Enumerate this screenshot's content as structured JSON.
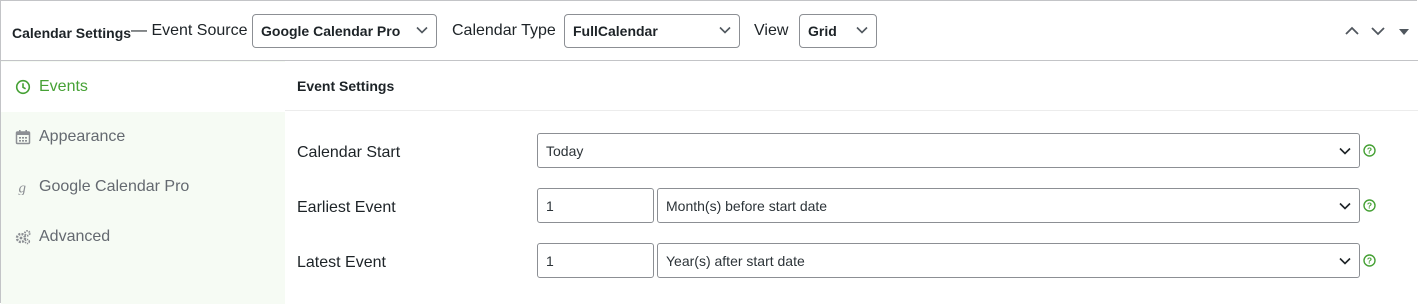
{
  "header": {
    "title": "Calendar Settings",
    "dash_label": "— Event Source",
    "event_source": "Google Calendar Pro",
    "calendar_type_label": "Calendar Type",
    "calendar_type": "FullCalendar",
    "view_label": "View",
    "view": "Grid"
  },
  "sidebar": {
    "tabs": [
      {
        "label": "Events",
        "icon": "clock-icon",
        "active": true
      },
      {
        "label": "Appearance",
        "icon": "calendar-icon",
        "active": false
      },
      {
        "label": "Google Calendar Pro",
        "icon": "google-g-icon",
        "active": false
      },
      {
        "label": "Advanced",
        "icon": "gears-icon",
        "active": false
      }
    ]
  },
  "main": {
    "title": "Event Settings",
    "calendar_start": {
      "label": "Calendar Start",
      "value": "Today"
    },
    "earliest_event": {
      "label": "Earliest Event",
      "number": "1",
      "unit": "Month(s) before start date"
    },
    "latest_event": {
      "label": "Latest Event",
      "number": "1",
      "unit": "Year(s) after start date"
    }
  },
  "colors": {
    "accent_green": "#46a135",
    "sidebar_bg": "#f6fbf4",
    "border": "#8c8f94"
  }
}
